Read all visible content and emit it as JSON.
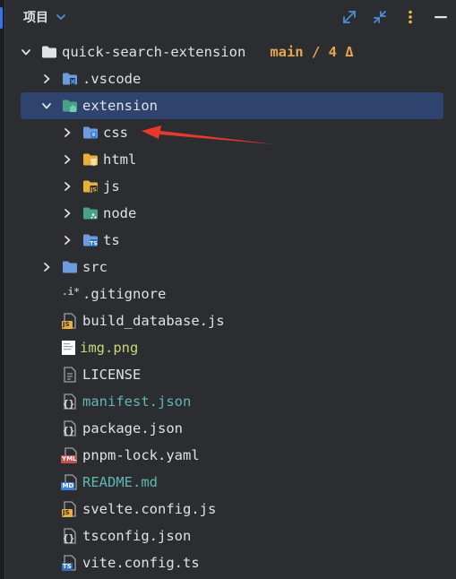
{
  "header": {
    "title": "项目"
  },
  "tree": {
    "root": {
      "name": "quick-search-extension",
      "branch": "main / 4 Δ"
    },
    "vscode": {
      "name": ".vscode"
    },
    "extension": {
      "name": "extension"
    },
    "css": {
      "name": "css"
    },
    "html": {
      "name": "html"
    },
    "js": {
      "name": "js"
    },
    "node": {
      "name": "node"
    },
    "ts": {
      "name": "ts"
    },
    "src": {
      "name": "src"
    },
    "files": [
      {
        "name": ".gitignore",
        "badge": ".i*"
      },
      {
        "name": "build_database.js",
        "badge": "JS"
      },
      {
        "name": "img.png"
      },
      {
        "name": "LICENSE"
      },
      {
        "name": "manifest.json",
        "badge": "{}"
      },
      {
        "name": "package.json",
        "badge": "{}"
      },
      {
        "name": "pnpm-lock.yaml",
        "badge": "YML"
      },
      {
        "name": "README.md",
        "badge": "MD"
      },
      {
        "name": "svelte.config.js",
        "badge": "JS"
      },
      {
        "name": "tsconfig.json",
        "badge": "{}"
      },
      {
        "name": "vite.config.ts",
        "badge": "TS"
      }
    ]
  },
  "colors": {
    "background": "#2b2d30",
    "selection": "#2e436e",
    "folder": "#6f9bdc",
    "branch": "#e4a54f",
    "annotation": "#e8392b"
  }
}
